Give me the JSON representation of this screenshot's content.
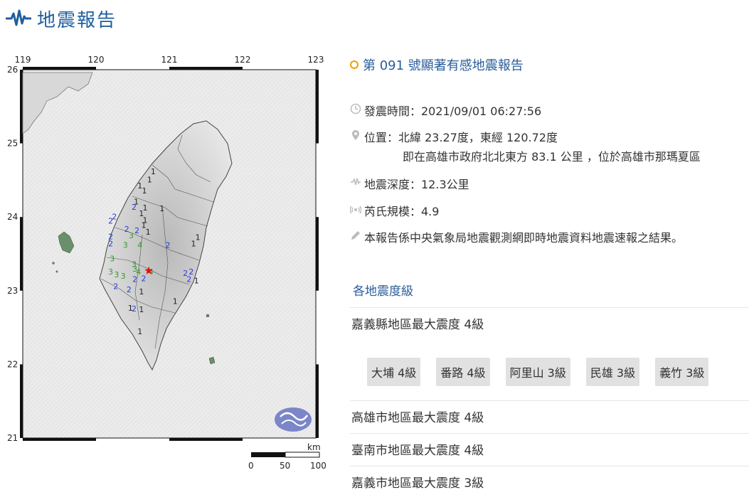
{
  "header": {
    "title": "地震報告"
  },
  "map": {
    "lon_ticks": [
      "119",
      "120",
      "121",
      "122",
      "123"
    ],
    "lat_ticks": [
      "26",
      "25",
      "24",
      "23",
      "22",
      "21"
    ],
    "scale_unit": "km",
    "scale_labels": [
      "0",
      "50",
      "100"
    ],
    "epicenter_color": "#e01010",
    "intensity_colors": {
      "1": "#222222",
      "2": "#2a3ad8",
      "3": "#2f9a2f",
      "4": "#2f9a2f"
    },
    "markers": [
      {
        "v": "1",
        "lon": 120.78,
        "lat": 24.58
      },
      {
        "v": "1",
        "lon": 120.73,
        "lat": 24.47
      },
      {
        "v": "1",
        "lon": 120.6,
        "lat": 24.39
      },
      {
        "v": "1",
        "lon": 120.66,
        "lat": 24.32
      },
      {
        "v": "1",
        "lon": 120.55,
        "lat": 24.17
      },
      {
        "v": "2",
        "lon": 120.52,
        "lat": 24.1
      },
      {
        "v": "1",
        "lon": 120.67,
        "lat": 24.09
      },
      {
        "v": "1",
        "lon": 120.9,
        "lat": 24.08
      },
      {
        "v": "1",
        "lon": 120.62,
        "lat": 24.01
      },
      {
        "v": "2",
        "lon": 120.25,
        "lat": 23.97
      },
      {
        "v": "2",
        "lon": 120.2,
        "lat": 23.91
      },
      {
        "v": "1",
        "lon": 120.67,
        "lat": 23.92
      },
      {
        "v": "1",
        "lon": 120.65,
        "lat": 23.85
      },
      {
        "v": "2",
        "lon": 120.42,
        "lat": 23.8
      },
      {
        "v": "2",
        "lon": 120.56,
        "lat": 23.78
      },
      {
        "v": "2",
        "lon": 120.2,
        "lat": 23.7
      },
      {
        "v": "3",
        "lon": 120.48,
        "lat": 23.71
      },
      {
        "v": "1",
        "lon": 120.71,
        "lat": 23.76
      },
      {
        "v": "1",
        "lon": 121.39,
        "lat": 23.69
      },
      {
        "v": "2",
        "lon": 120.2,
        "lat": 23.6
      },
      {
        "v": "3",
        "lon": 120.4,
        "lat": 23.58
      },
      {
        "v": "4",
        "lon": 120.6,
        "lat": 23.58
      },
      {
        "v": "2",
        "lon": 120.98,
        "lat": 23.58
      },
      {
        "v": "1",
        "lon": 121.33,
        "lat": 23.6
      },
      {
        "v": "3",
        "lon": 120.22,
        "lat": 23.4
      },
      {
        "v": "3",
        "lon": 120.52,
        "lat": 23.32
      },
      {
        "v": "3",
        "lon": 120.53,
        "lat": 23.26
      },
      {
        "v": "4",
        "lon": 120.75,
        "lat": 23.22
      },
      {
        "v": "4",
        "lon": 120.58,
        "lat": 23.22
      },
      {
        "v": "3",
        "lon": 120.2,
        "lat": 23.22
      },
      {
        "v": "3",
        "lon": 120.28,
        "lat": 23.18
      },
      {
        "v": "3",
        "lon": 120.37,
        "lat": 23.16
      },
      {
        "v": "2",
        "lon": 120.65,
        "lat": 23.13
      },
      {
        "v": "2",
        "lon": 120.53,
        "lat": 23.12
      },
      {
        "v": "2",
        "lon": 121.22,
        "lat": 23.2
      },
      {
        "v": "2",
        "lon": 121.3,
        "lat": 23.22
      },
      {
        "v": "2",
        "lon": 121.27,
        "lat": 23.12
      },
      {
        "v": "1",
        "lon": 121.37,
        "lat": 23.1
      },
      {
        "v": "2",
        "lon": 120.27,
        "lat": 23.02
      },
      {
        "v": "2",
        "lon": 120.45,
        "lat": 22.98
      },
      {
        "v": "1",
        "lon": 120.62,
        "lat": 22.95
      },
      {
        "v": "1",
        "lon": 120.47,
        "lat": 22.73
      },
      {
        "v": "2",
        "lon": 120.52,
        "lat": 22.72
      },
      {
        "v": "1",
        "lon": 120.62,
        "lat": 22.71
      },
      {
        "v": "1",
        "lon": 121.08,
        "lat": 22.82
      },
      {
        "v": "1",
        "lon": 120.6,
        "lat": 22.41
      }
    ],
    "epicenter": {
      "lon": 120.72,
      "lat": 23.27
    }
  },
  "report": {
    "title": "第 091 號顯著有感地震報告",
    "time_label": "發震時間：2021/09/01 06:27:56",
    "location_label": "位置：北緯 23.27度，東經 120.72度",
    "location_detail": "即在高雄市政府北北東方 83.1 公里 ，位於高雄市那瑪夏區",
    "depth_label": "地震深度：12.3公里",
    "magnitude_label": "芮氏規模：4.9",
    "note": "本報告係中央氣象局地震觀測網即時地震資料地震速報之結果。"
  },
  "intensity": {
    "section_title": "各地震度級",
    "regions": [
      "嘉義縣地區最大震度 4級",
      "高雄市地區最大震度 4級",
      "臺南市地區最大震度 4級",
      "嘉義市地區最大震度 3級"
    ],
    "stations": [
      "大埔 4級",
      "番路 4級",
      "阿里山 3級",
      "民雄 3級",
      "義竹 3級"
    ]
  }
}
